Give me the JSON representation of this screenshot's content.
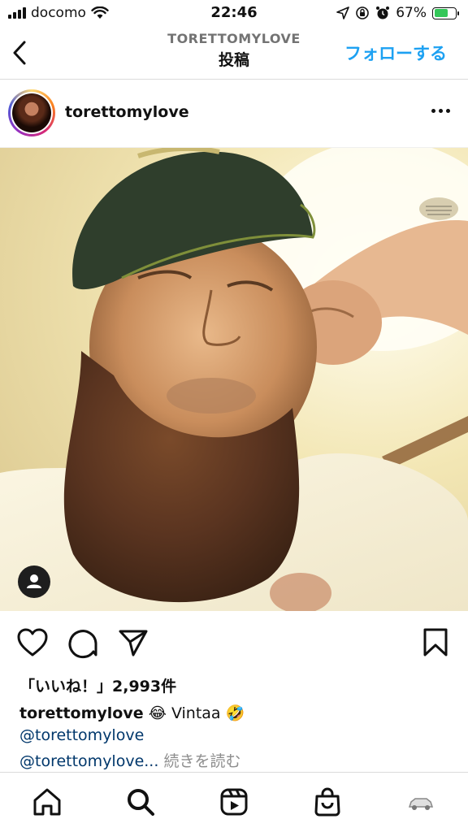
{
  "status_bar": {
    "carrier": "docomo",
    "time": "22:46",
    "battery": "67%"
  },
  "nav": {
    "username": "TORETTOMYLOVE",
    "title": "投稿",
    "follow_label": "フォローする"
  },
  "post": {
    "username": "torettomylove",
    "likes": "「いいね！」2,993件",
    "caption_user": "torettomylove",
    "caption_emoji1": "😂",
    "caption_text": "Vintaa",
    "caption_emoji2": "🤣",
    "mention1": "@torettomylove",
    "mention2": "@torettomylove...",
    "more_label": "続きを読む"
  },
  "colors": {
    "accent": "#1da1f2",
    "mention": "#00376b",
    "battery": "#34c759"
  },
  "icons": {
    "status": [
      "signal-icon",
      "wifi-icon",
      "location-icon",
      "lock-rotation-icon",
      "alarm-icon",
      "battery-icon"
    ],
    "actions": [
      "heart-icon",
      "comment-icon",
      "share-icon",
      "bookmark-icon"
    ],
    "tabs": [
      "home-icon",
      "search-icon",
      "reels-icon",
      "shop-icon",
      "profile-icon"
    ]
  }
}
